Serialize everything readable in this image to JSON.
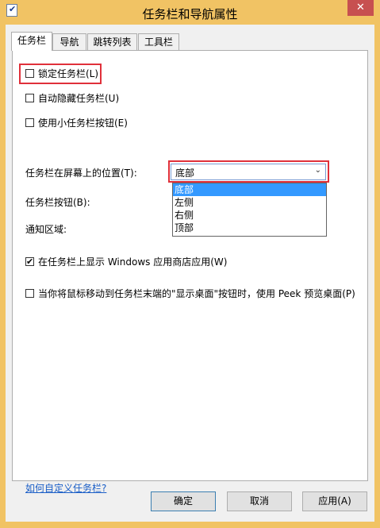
{
  "window": {
    "title": "任务栏和导航属性",
    "close_glyph": "✕"
  },
  "tabs": [
    {
      "label": "任务栏",
      "active": true
    },
    {
      "label": "导航",
      "active": false
    },
    {
      "label": "跳转列表",
      "active": false
    },
    {
      "label": "工具栏",
      "active": false
    }
  ],
  "options": {
    "lock_taskbar": {
      "label": "锁定任务栏(L)",
      "checked": false
    },
    "auto_hide": {
      "label": "自动隐藏任务栏(U)",
      "checked": false
    },
    "small_buttons": {
      "label": "使用小任务栏按钮(E)",
      "checked": false
    },
    "show_store_apps": {
      "label": "在任务栏上显示 Windows 应用商店应用(W)",
      "checked": true
    },
    "peek": {
      "label": "当你将鼠标移动到任务栏末端的\"显示桌面\"按钮时，使用 Peek 预览桌面(P)",
      "checked": false
    }
  },
  "position": {
    "label": "任务栏在屏幕上的位置(T):",
    "selected": "底部",
    "options": [
      "底部",
      "左侧",
      "右侧",
      "顶部"
    ],
    "selected_index": 0
  },
  "labels": {
    "taskbar_buttons": "任务栏按钮(B):",
    "notification_area": "通知区域:"
  },
  "link": "如何自定义任务栏?",
  "buttons": {
    "ok": "确定",
    "cancel": "取消",
    "apply": "应用(A)"
  },
  "colors": {
    "frame": "#f1c364",
    "highlight_box": "#e0303a",
    "selected_option": "#3399ff",
    "link": "#1a5ec7"
  }
}
